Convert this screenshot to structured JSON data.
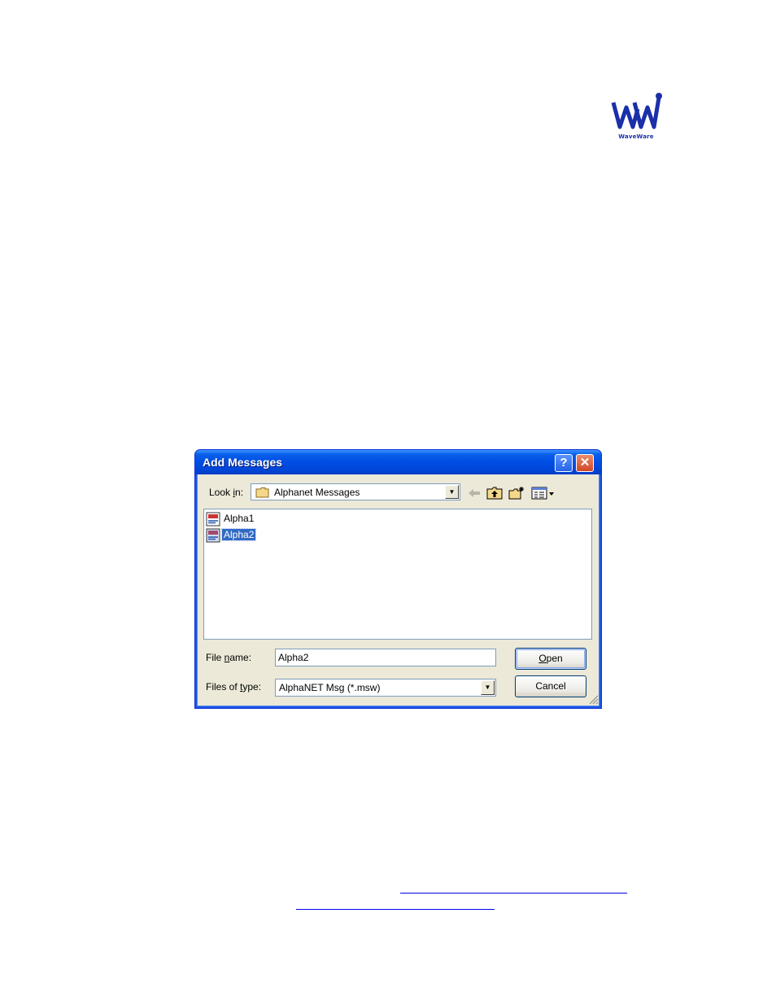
{
  "logo": {
    "caption": "WaveWare"
  },
  "dialog": {
    "title": "Add Messages",
    "help_glyph": "?",
    "close_glyph": "✕",
    "look_in": {
      "label_pre": "Look ",
      "label_mnemonic": "i",
      "label_post": "n:",
      "value": "Alphanet Messages"
    },
    "toolbar_icons": [
      "back-arrow-icon",
      "up-folder-icon",
      "new-folder-icon",
      "view-menu-icon"
    ],
    "files": [
      {
        "name": "Alpha1",
        "selected": false
      },
      {
        "name": "Alpha2",
        "selected": true
      }
    ],
    "file_name": {
      "label_pre": "File ",
      "label_mnemonic": "n",
      "label_post": "ame:",
      "value": "Alpha2"
    },
    "files_of_type": {
      "label_pre": "Files of ",
      "label_mnemonic": "t",
      "label_post": "ype:",
      "value": "AlphaNET Msg (*.msw)"
    },
    "open_button": {
      "mnemonic": "O",
      "rest": "pen"
    },
    "cancel_button": "Cancel",
    "colors": {
      "title_bar": "#0050e6",
      "selection": "#316ac5",
      "face": "#ece9d8"
    }
  }
}
